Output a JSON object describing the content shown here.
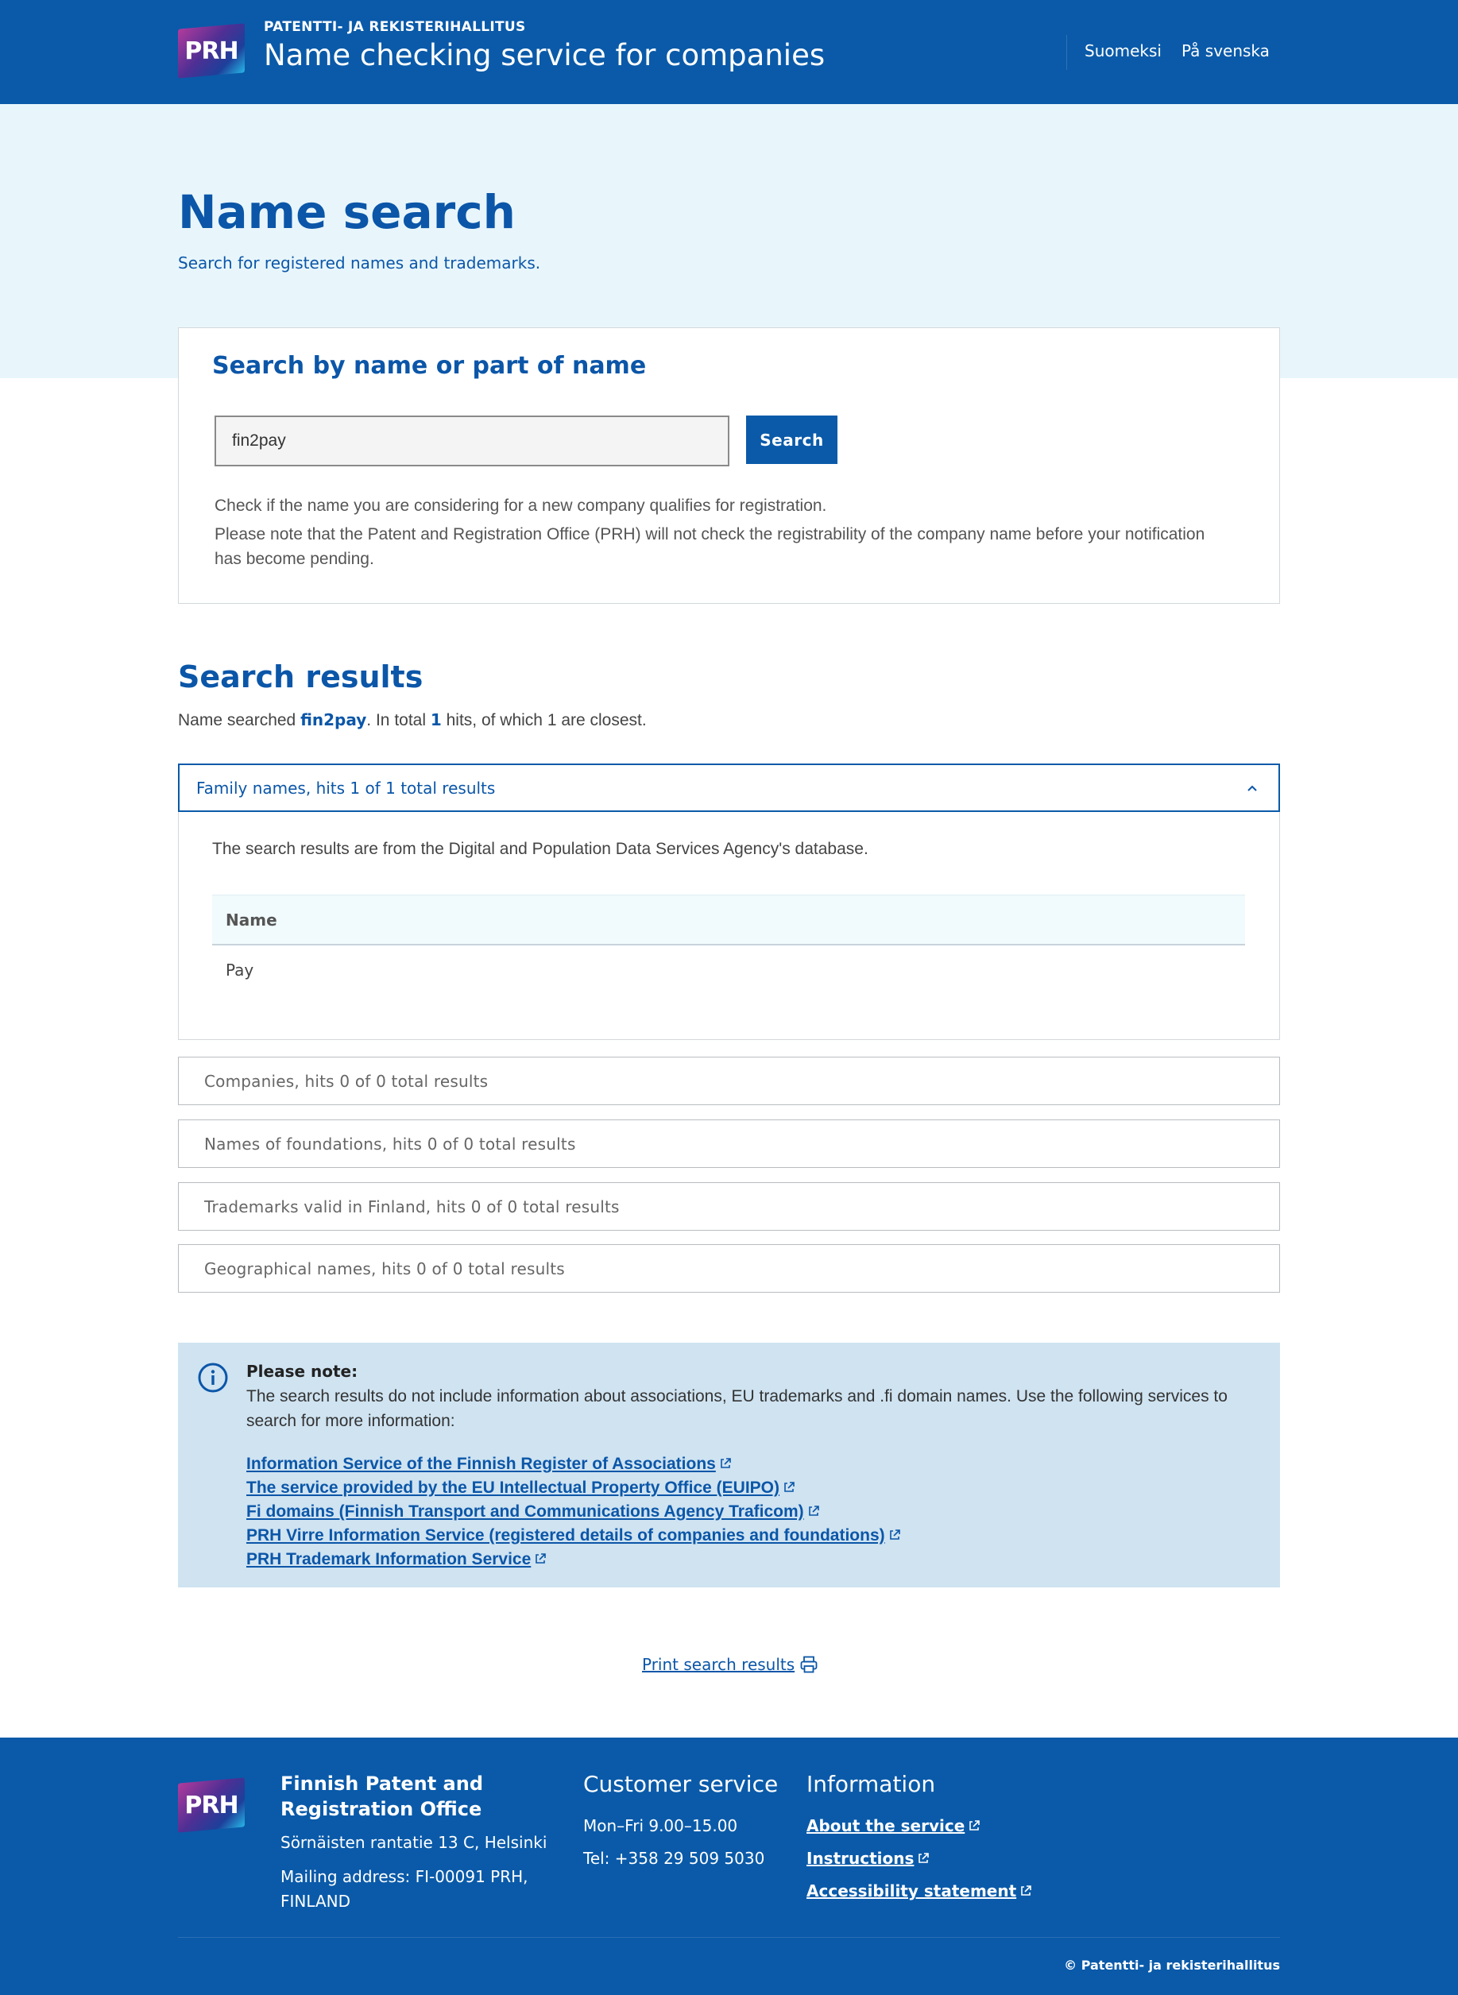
{
  "header": {
    "logo_text": "PRH",
    "org_name": "PATENTTI- JA REKISTERIHALLITUS",
    "app_title": "Name checking service for companies",
    "languages": [
      "Suomeksi",
      "På svenska"
    ]
  },
  "hero": {
    "title": "Name search",
    "subtitle": "Search for registered names and trademarks."
  },
  "search": {
    "heading": "Search by name or part of name",
    "input_value": "fin2pay",
    "button_label": "Search",
    "info_1": "Check if the name you are considering for a new company qualifies for registration.",
    "info_2": "Please note that the Patent and Registration Office (PRH) will not check the registrability of the company name before your notification has become pending."
  },
  "results": {
    "title": "Search results",
    "summary_prefix": "Name searched ",
    "searched_name": "fin2pay",
    "summary_mid": ". In total ",
    "total_hits": "1",
    "summary_suffix": " hits, of which 1 are closest.",
    "open_section": {
      "label": "Family names, hits 1 of 1 total results",
      "source_note": "The search results are from the Digital and Population Data Services Agency's database.",
      "column_header": "Name",
      "rows": [
        "Pay"
      ]
    },
    "closed_sections": [
      "Companies, hits 0 of 0 total results",
      "Names of foundations, hits 0 of 0 total results",
      "Trademarks valid in Finland, hits 0 of 0 total results",
      "Geographical names, hits 0 of 0 total results"
    ]
  },
  "note": {
    "title": "Please note:",
    "text": "The search results do not include information about associations, EU trademarks and .fi domain names. Use the following services to search for more information:",
    "links": [
      "Information Service of the Finnish Register of Associations",
      "The service provided by the EU Intellectual Property Office (EUIPO)",
      "Fi domains (Finnish Transport and Communications Agency Traficom)",
      "PRH Virre Information Service (registered details of companies and foundations)",
      "PRH Trademark Information Service"
    ]
  },
  "print_label": "Print search results",
  "footer": {
    "org_name": "Finnish Patent and Registration Office",
    "address": "Sörnäisten rantatie 13 C, Helsinki",
    "mailing": "Mailing address: FI-00091 PRH, FINLAND",
    "cs_heading": "Customer service",
    "cs_hours": "Mon–Fri 9.00–15.00",
    "cs_phone": "Tel: +358 29 509 5030",
    "info_heading": "Information",
    "info_links": [
      "About the service",
      "Instructions",
      "Accessibility statement"
    ],
    "copyright": "© Patentti- ja rekisterihallitus"
  },
  "colors": {
    "brand_blue": "#0a5aa9",
    "hero_bg": "#e8f6fb",
    "note_bg": "#cfe3f1"
  }
}
